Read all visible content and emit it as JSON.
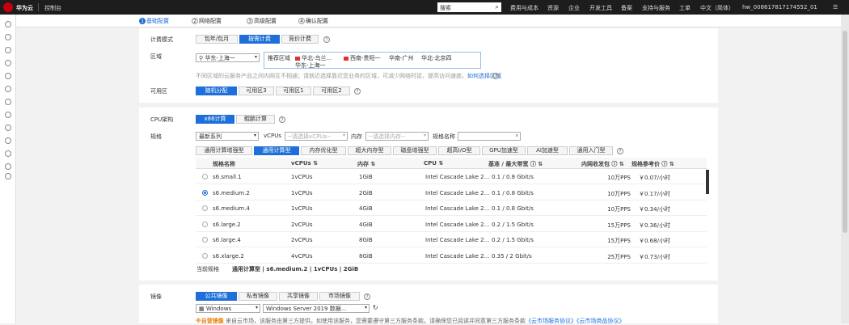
{
  "topbar": {
    "brand": "华为云",
    "console": "控制台",
    "search_placeholder": "搜索",
    "nav": [
      "费用与成本",
      "资源",
      "企业",
      "开发工具",
      "备案",
      "支持与服务",
      "工单",
      "中文（简体）",
      "hw_008617817174552_01"
    ]
  },
  "steps": [
    {
      "num": "1",
      "label": "基础配置"
    },
    {
      "num": "2",
      "label": "网络配置"
    },
    {
      "num": "3",
      "label": "高级配置"
    },
    {
      "num": "4",
      "label": "确认配置"
    }
  ],
  "billing": {
    "label": "计费模式",
    "options": [
      "包年/包月",
      "按需计费",
      "竞价计费"
    ],
    "selected": "按需计费"
  },
  "region": {
    "label": "区域",
    "value": "华东-上海一",
    "recommend_label": "推荐区域",
    "items": [
      "华北-乌兰...",
      "西南-贵阳一",
      "华南-广州",
      "华北-北京四",
      "华东-上海一"
    ],
    "note": "不同区域的云服务产品之间内网互不相通；请就近选择靠近您业务的区域，可减少网络时延，提高访问速度。",
    "note_link": "如何选择区域"
  },
  "az": {
    "label": "可用区",
    "options": [
      "随机分配",
      "可用区3",
      "可用区1",
      "可用区2"
    ],
    "selected": "随机分配"
  },
  "cpu_arch": {
    "label": "CPU架构",
    "options": [
      "x86计算",
      "鲲鹏计算"
    ],
    "selected": "x86计算"
  },
  "spec": {
    "label": "规格",
    "series_value": "最新系列",
    "vcpus_label": "vCPUs",
    "vcpus_placeholder": "--请选择vCPUs--",
    "mem_label": "内存",
    "mem_placeholder": "--请选择内存--",
    "name_label": "规格名称"
  },
  "spec_tabs": {
    "items": [
      "通用计算增强型",
      "通用计算型",
      "内存优化型",
      "超大内存型",
      "磁盘增强型",
      "超高I/O型",
      "GPU加速型",
      "AI加速型",
      "通用入门型"
    ],
    "selected": "通用计算型"
  },
  "table": {
    "headers": [
      "规格名称",
      "vCPUs ⇅",
      "内存 ⇅",
      "CPU ⇅",
      "基准 / 最大带宽 ⓘ ⇅",
      "内网收发包 ⓘ ⇅",
      "规格参考价 ⓘ ⇅"
    ],
    "rows": [
      {
        "name": "s6.small.1",
        "vcpus": "1vCPUs",
        "mem": "1GiB",
        "cpu": "Intel Cascade Lake 2...",
        "bw": "0.1 / 0.8 Gbit/s",
        "pps": "10万PPS",
        "price": "￥0.07/小时",
        "selected": false
      },
      {
        "name": "s6.medium.2",
        "vcpus": "1vCPUs",
        "mem": "2GiB",
        "cpu": "Intel Cascade Lake 2...",
        "bw": "0.1 / 0.8 Gbit/s",
        "pps": "10万PPS",
        "price": "￥0.17/小时",
        "selected": true
      },
      {
        "name": "s6.medium.4",
        "vcpus": "1vCPUs",
        "mem": "4GiB",
        "cpu": "Intel Cascade Lake 2...",
        "bw": "0.1 / 0.8 Gbit/s",
        "pps": "10万PPS",
        "price": "￥0.34/小时",
        "selected": false
      },
      {
        "name": "s6.large.2",
        "vcpus": "2vCPUs",
        "mem": "4GiB",
        "cpu": "Intel Cascade Lake 2...",
        "bw": "0.2 / 1.5 Gbit/s",
        "pps": "15万PPS",
        "price": "￥0.36/小时",
        "selected": false
      },
      {
        "name": "s6.large.4",
        "vcpus": "2vCPUs",
        "mem": "8GiB",
        "cpu": "Intel Cascade Lake 2...",
        "bw": "0.2 / 1.5 Gbit/s",
        "pps": "15万PPS",
        "price": "￥0.68/小时",
        "selected": false
      },
      {
        "name": "s6.xlarge.2",
        "vcpus": "4vCPUs",
        "mem": "8GiB",
        "cpu": "Intel Cascade Lake 2...",
        "bw": "0.35 / 2 Gbit/s",
        "pps": "25万PPS",
        "price": "￥0.73/小时",
        "selected": false
      }
    ]
  },
  "current_spec": {
    "label": "当前规格",
    "value": "通用计算型 | s6.medium.2 | 1vCPUs | 2GiB"
  },
  "image": {
    "label": "镜像",
    "options": [
      "公共镜像",
      "私有镜像",
      "共享镜像",
      "市场镜像"
    ],
    "selected": "公共镜像",
    "os": "Windows",
    "version": "Windows Server 2019 数据...",
    "warn_label": "※自营镜像",
    "note": "来自云市场，该服务由第三方提供。如使用该服务，您需要遵守第三方服务条款。请确保您已阅读并同意第三方服务条款",
    "link1": "《云市场服务协议》",
    "link2": "《云市场商品协议》"
  }
}
